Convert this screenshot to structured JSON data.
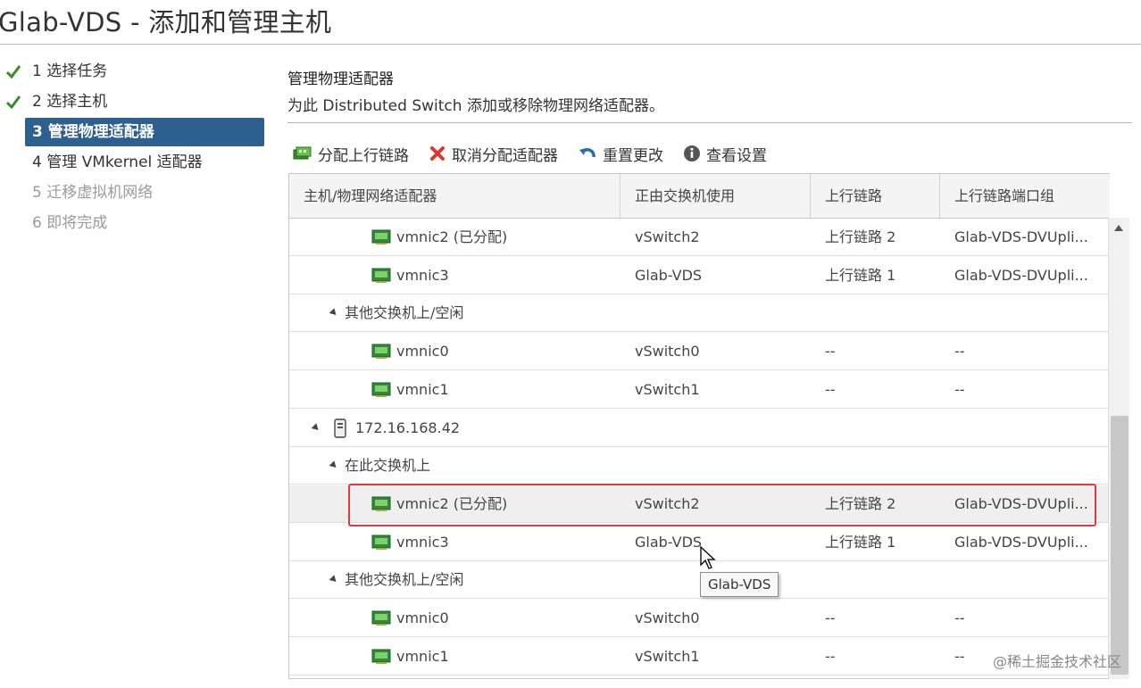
{
  "window": {
    "title": "Glab-VDS - 添加和管理主机"
  },
  "steps": [
    {
      "label": "1 选择任务",
      "state": "done"
    },
    {
      "label": "2 选择主机",
      "state": "done"
    },
    {
      "label": "3 管理物理适配器",
      "state": "active"
    },
    {
      "label": "4 管理 VMkernel 适配器",
      "state": "normal"
    },
    {
      "label": "5 迁移虚拟机网络",
      "state": "disabled"
    },
    {
      "label": "6 即将完成",
      "state": "disabled"
    }
  ],
  "section": {
    "title": "管理物理适配器",
    "description": "为此 Distributed Switch 添加或移除物理网络适配器。"
  },
  "toolbar": {
    "assign_uplink": "分配上行链路",
    "unassign_adapter": "取消分配适配器",
    "reset_changes": "重置更改",
    "view_settings": "查看设置"
  },
  "grid": {
    "columns": [
      "主机/物理网络适配器",
      "正由交换机使用",
      "上行链路",
      "上行链路端口组"
    ],
    "rows": [
      {
        "kind": "nic",
        "name": "vmnic2 (已分配)",
        "switch": "vSwitch2",
        "uplink": "上行链路 2",
        "portgroup": "Glab-VDS-DVUpli..."
      },
      {
        "kind": "nic",
        "name": "vmnic3",
        "switch": "Glab-VDS",
        "uplink": "上行链路 1",
        "portgroup": "Glab-VDS-DVUpli..."
      },
      {
        "kind": "group",
        "name": "其他交换机上/空闲"
      },
      {
        "kind": "nic",
        "name": "vmnic0",
        "switch": "vSwitch0",
        "uplink": "--",
        "portgroup": "--"
      },
      {
        "kind": "nic",
        "name": "vmnic1",
        "switch": "vSwitch1",
        "uplink": "--",
        "portgroup": "--"
      },
      {
        "kind": "host",
        "name": "172.16.168.42"
      },
      {
        "kind": "group",
        "name": "在此交换机上"
      },
      {
        "kind": "nic",
        "name": "vmnic2 (已分配)",
        "switch": "vSwitch2",
        "uplink": "上行链路 2",
        "portgroup": "Glab-VDS-DVUpli...",
        "selected": true
      },
      {
        "kind": "nic",
        "name": "vmnic3",
        "switch": "Glab-VDS",
        "uplink": "上行链路 1",
        "portgroup": "Glab-VDS-DVUpli..."
      },
      {
        "kind": "group",
        "name": "其他交换机上/空闲"
      },
      {
        "kind": "nic",
        "name": "vmnic0",
        "switch": "vSwitch0",
        "uplink": "--",
        "portgroup": "--"
      },
      {
        "kind": "nic",
        "name": "vmnic1",
        "switch": "vSwitch1",
        "uplink": "--",
        "portgroup": "--"
      }
    ]
  },
  "tooltip": {
    "text": "Glab-VDS"
  },
  "watermark": {
    "text": "@稀土掘金技术社区"
  },
  "colors": {
    "active_step": "#2d5f8f",
    "highlight": "#e03b3b",
    "check": "#3b8a2a",
    "nic": "#2e8b3a"
  }
}
